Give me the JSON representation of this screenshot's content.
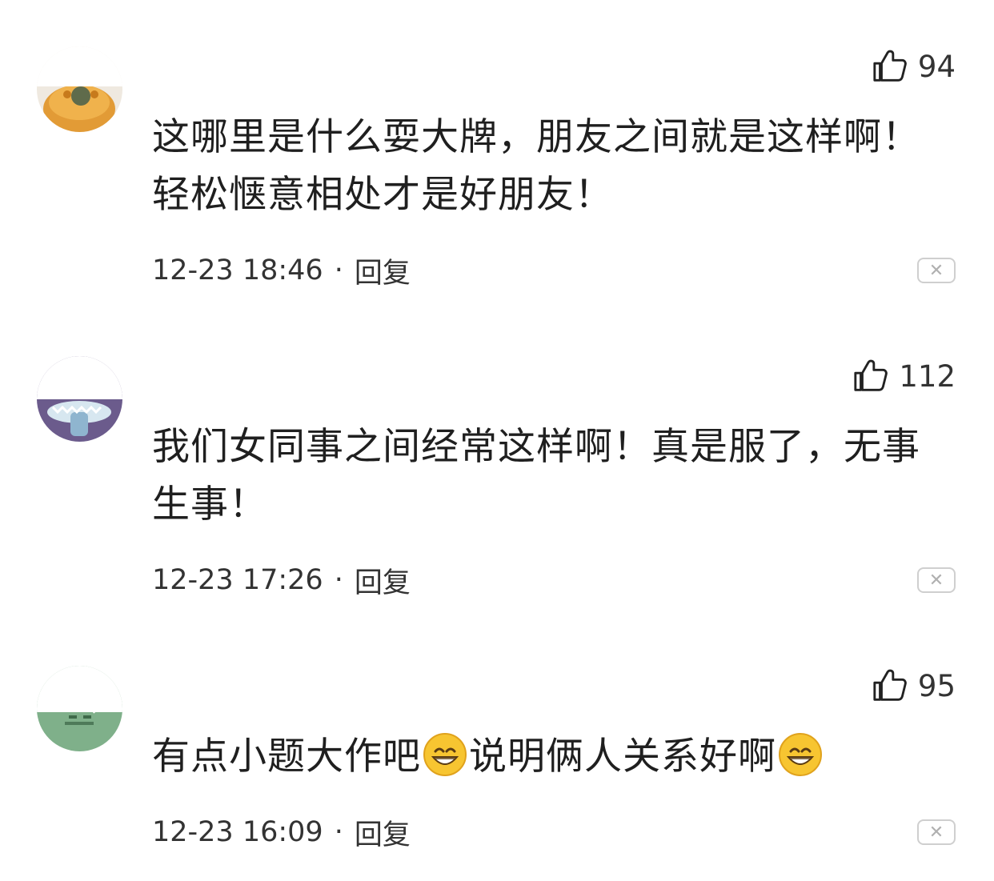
{
  "comments": [
    {
      "likes": "94",
      "text": "这哪里是什么耍大牌，朋友之间就是这样啊！轻松惬意相处才是好朋友！",
      "time": "12-23 18:46",
      "reply": "回复",
      "avatar_colors": [
        "#f2a33a",
        "#c77a1c",
        "#e8e8e8"
      ]
    },
    {
      "likes": "112",
      "text": "我们女同事之间经常这样啊！真是服了，无事生事！",
      "time": "12-23 17:26",
      "reply": "回复",
      "avatar_colors": [
        "#6e5a8e",
        "#8fb5cf",
        "#ffffff"
      ]
    },
    {
      "likes": "95",
      "text_parts": [
        "有点小题大作吧",
        "说明俩人关系好啊"
      ],
      "emojis": [
        "grinning-face-emoji",
        "grinning-face-emoji"
      ],
      "time": "12-23 16:09",
      "reply": "回复",
      "avatar_colors": [
        "#6fa37a",
        "#4e7a59",
        "#ffffff"
      ]
    }
  ],
  "separator": "·",
  "close_glyph": "✕"
}
